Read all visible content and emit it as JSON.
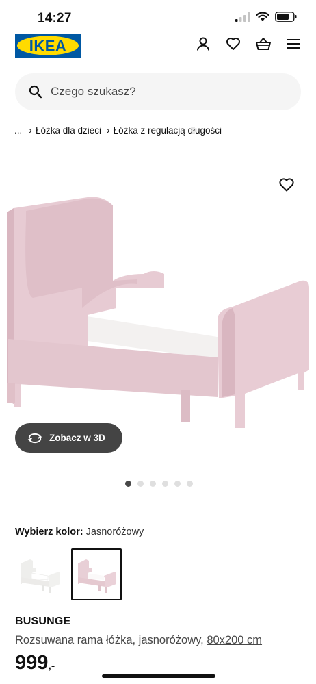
{
  "status_bar": {
    "time": "14:27"
  },
  "header": {
    "logo_text": "IKEA",
    "brand_colors": {
      "blue": "#0058a3",
      "yellow": "#ffdb00"
    },
    "icons": [
      "user-icon",
      "heart-icon",
      "basket-icon",
      "menu-icon"
    ]
  },
  "search": {
    "placeholder": "Czego szukasz?"
  },
  "breadcrumb": {
    "ellipsis": "...",
    "items": [
      "Łóżka dla dzieci",
      "Łóżka z regulacją długości"
    ]
  },
  "gallery": {
    "view3d_label": "Zobacz w 3D",
    "slide_count": 6,
    "active_slide": 1
  },
  "color_picker": {
    "label": "Wybierz kolor:",
    "selected": "Jasnoróżowy",
    "options": [
      {
        "name": "white",
        "color": "#f4f4f2"
      },
      {
        "name": "light pink",
        "color": "#e8cfd6"
      }
    ],
    "selected_index": 1
  },
  "product": {
    "name": "BUSUNGE",
    "description": "Rozsuwana rama łóżka, jasnoróżowy,",
    "size": "80x200 cm",
    "price": "999",
    "price_suffix": ",-"
  }
}
